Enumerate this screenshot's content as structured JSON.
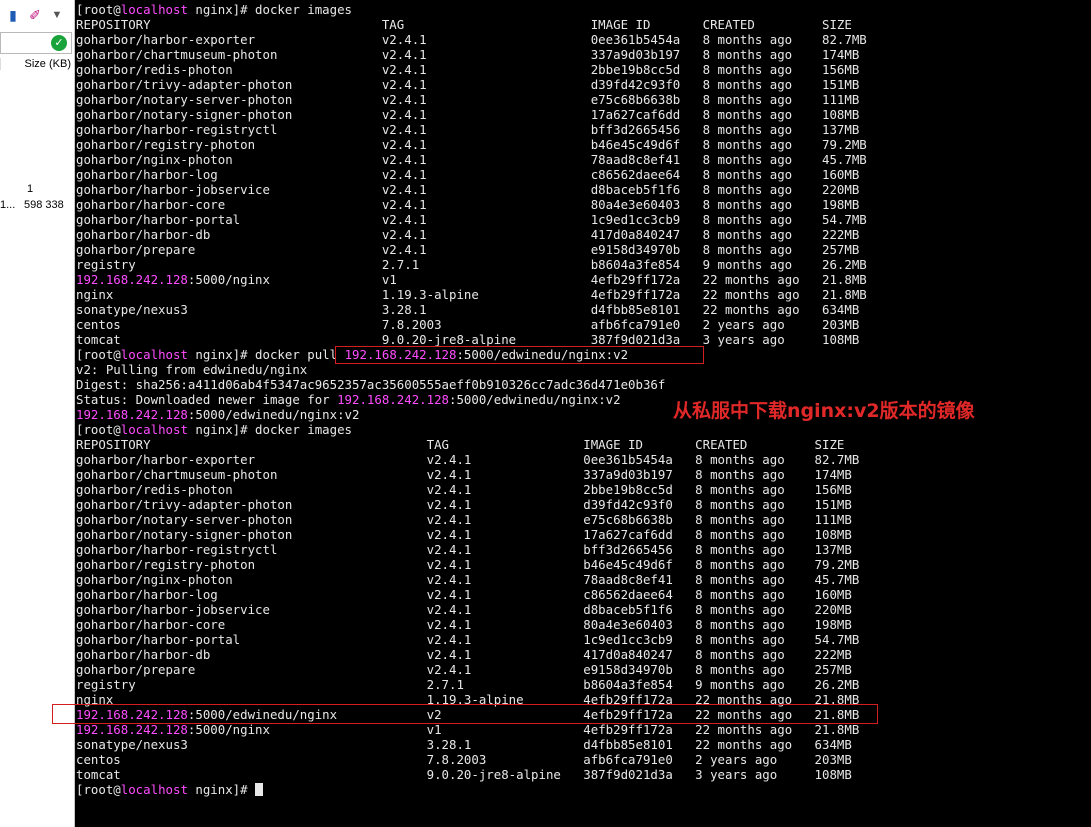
{
  "left_panel": {
    "toolbar_icons": [
      "cursor-icon",
      "color-picker-icon",
      "dropdown-icon"
    ],
    "size_header": "Size (KB)",
    "value_1": "1",
    "value_2_prefix": "1...",
    "value_2": "598 338"
  },
  "terminal": {
    "prompt": "[root@localhost nginx]# ",
    "prompt_host": "localhost",
    "commands": [
      "docker images",
      "docker pull 192.168.242.128:5000/edwinedu/nginx:v2",
      "docker images"
    ],
    "header_1": [
      "REPOSITORY",
      "TAG",
      "IMAGE ID",
      "CREATED",
      "SIZE"
    ],
    "rows_1": [
      [
        "goharbor/harbor-exporter",
        "v2.4.1",
        "0ee361b5454a",
        "8 months ago",
        "82.7MB"
      ],
      [
        "goharbor/chartmuseum-photon",
        "v2.4.1",
        "337a9d03b197",
        "8 months ago",
        "174MB"
      ],
      [
        "goharbor/redis-photon",
        "v2.4.1",
        "2bbe19b8cc5d",
        "8 months ago",
        "156MB"
      ],
      [
        "goharbor/trivy-adapter-photon",
        "v2.4.1",
        "d39fd42c93f0",
        "8 months ago",
        "151MB"
      ],
      [
        "goharbor/notary-server-photon",
        "v2.4.1",
        "e75c68b6638b",
        "8 months ago",
        "111MB"
      ],
      [
        "goharbor/notary-signer-photon",
        "v2.4.1",
        "17a627caf6dd",
        "8 months ago",
        "108MB"
      ],
      [
        "goharbor/harbor-registryctl",
        "v2.4.1",
        "bff3d2665456",
        "8 months ago",
        "137MB"
      ],
      [
        "goharbor/registry-photon",
        "v2.4.1",
        "b46e45c49d6f",
        "8 months ago",
        "79.2MB"
      ],
      [
        "goharbor/nginx-photon",
        "v2.4.1",
        "78aad8c8ef41",
        "8 months ago",
        "45.7MB"
      ],
      [
        "goharbor/harbor-log",
        "v2.4.1",
        "c86562daee64",
        "8 months ago",
        "160MB"
      ],
      [
        "goharbor/harbor-jobservice",
        "v2.4.1",
        "d8baceb5f1f6",
        "8 months ago",
        "220MB"
      ],
      [
        "goharbor/harbor-core",
        "v2.4.1",
        "80a4e3e60403",
        "8 months ago",
        "198MB"
      ],
      [
        "goharbor/harbor-portal",
        "v2.4.1",
        "1c9ed1cc3cb9",
        "8 months ago",
        "54.7MB"
      ],
      [
        "goharbor/harbor-db",
        "v2.4.1",
        "417d0a840247",
        "8 months ago",
        "222MB"
      ],
      [
        "goharbor/prepare",
        "v2.4.1",
        "e9158d34970b",
        "8 months ago",
        "257MB"
      ],
      [
        "registry",
        "2.7.1",
        "b8604a3fe854",
        "9 months ago",
        "26.2MB"
      ],
      [
        "192.168.242.128:5000/nginx",
        "v1",
        "4efb29ff172a",
        "22 months ago",
        "21.8MB"
      ],
      [
        "nginx",
        "1.19.3-alpine",
        "4efb29ff172a",
        "22 months ago",
        "21.8MB"
      ],
      [
        "sonatype/nexus3",
        "3.28.1",
        "d4fbb85e8101",
        "22 months ago",
        "634MB"
      ],
      [
        "centos",
        "7.8.2003",
        "afb6fca791e0",
        "2 years ago",
        "203MB"
      ],
      [
        "tomcat",
        "9.0.20-jre8-alpine",
        "387f9d021d3a",
        "3 years ago",
        "108MB"
      ]
    ],
    "pull_output": [
      "v2: Pulling from edwinedu/nginx",
      "Digest: sha256:a411d06ab4f5347ac9652357ac35600555aeff0b910326cc7adc36d471e0b36f",
      "Status: Downloaded newer image for 192.168.242.128:5000/edwinedu/nginx:v2",
      "192.168.242.128:5000/edwinedu/nginx:v2"
    ],
    "header_2": [
      "REPOSITORY",
      "TAG",
      "IMAGE ID",
      "CREATED",
      "SIZE"
    ],
    "rows_2": [
      [
        "goharbor/harbor-exporter",
        "v2.4.1",
        "0ee361b5454a",
        "8 months ago",
        "82.7MB"
      ],
      [
        "goharbor/chartmuseum-photon",
        "v2.4.1",
        "337a9d03b197",
        "8 months ago",
        "174MB"
      ],
      [
        "goharbor/redis-photon",
        "v2.4.1",
        "2bbe19b8cc5d",
        "8 months ago",
        "156MB"
      ],
      [
        "goharbor/trivy-adapter-photon",
        "v2.4.1",
        "d39fd42c93f0",
        "8 months ago",
        "151MB"
      ],
      [
        "goharbor/notary-server-photon",
        "v2.4.1",
        "e75c68b6638b",
        "8 months ago",
        "111MB"
      ],
      [
        "goharbor/notary-signer-photon",
        "v2.4.1",
        "17a627caf6dd",
        "8 months ago",
        "108MB"
      ],
      [
        "goharbor/harbor-registryctl",
        "v2.4.1",
        "bff3d2665456",
        "8 months ago",
        "137MB"
      ],
      [
        "goharbor/registry-photon",
        "v2.4.1",
        "b46e45c49d6f",
        "8 months ago",
        "79.2MB"
      ],
      [
        "goharbor/nginx-photon",
        "v2.4.1",
        "78aad8c8ef41",
        "8 months ago",
        "45.7MB"
      ],
      [
        "goharbor/harbor-log",
        "v2.4.1",
        "c86562daee64",
        "8 months ago",
        "160MB"
      ],
      [
        "goharbor/harbor-jobservice",
        "v2.4.1",
        "d8baceb5f1f6",
        "8 months ago",
        "220MB"
      ],
      [
        "goharbor/harbor-core",
        "v2.4.1",
        "80a4e3e60403",
        "8 months ago",
        "198MB"
      ],
      [
        "goharbor/harbor-portal",
        "v2.4.1",
        "1c9ed1cc3cb9",
        "8 months ago",
        "54.7MB"
      ],
      [
        "goharbor/harbor-db",
        "v2.4.1",
        "417d0a840247",
        "8 months ago",
        "222MB"
      ],
      [
        "goharbor/prepare",
        "v2.4.1",
        "e9158d34970b",
        "8 months ago",
        "257MB"
      ],
      [
        "registry",
        "2.7.1",
        "b8604a3fe854",
        "9 months ago",
        "26.2MB"
      ],
      [
        "nginx",
        "1.19.3-alpine",
        "4efb29ff172a",
        "22 months ago",
        "21.8MB"
      ],
      [
        "192.168.242.128:5000/edwinedu/nginx",
        "v2",
        "4efb29ff172a",
        "22 months ago",
        "21.8MB"
      ],
      [
        "192.168.242.128:5000/nginx",
        "v1",
        "4efb29ff172a",
        "22 months ago",
        "21.8MB"
      ],
      [
        "sonatype/nexus3",
        "3.28.1",
        "d4fbb85e8101",
        "22 months ago",
        "634MB"
      ],
      [
        "centos",
        "7.8.2003",
        "afb6fca791e0",
        "2 years ago",
        "203MB"
      ],
      [
        "tomcat",
        "9.0.20-jre8-alpine",
        "387f9d021d3a",
        "3 years ago",
        "108MB"
      ]
    ],
    "highlight_ip": "192.168.242.128"
  },
  "annotation": "从私服中下载nginx:v2版本的镜像",
  "colors": {
    "background": "#000000",
    "text": "#e8e8e8",
    "highlight": "#ff4dff",
    "annotation": "#e02828"
  }
}
